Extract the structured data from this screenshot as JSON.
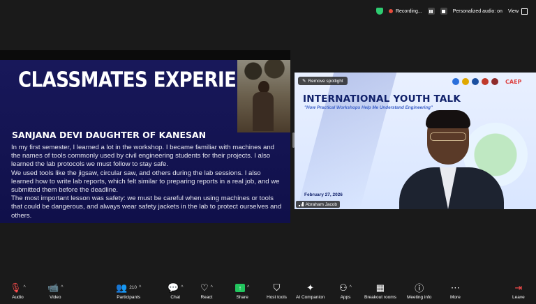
{
  "topbar": {
    "recording_label": "Recording...",
    "audio_label": "Personalized audio: on",
    "view_label": "View"
  },
  "slide": {
    "title": "CLASSMATES EXPERIENCE",
    "subtitle": "SANJANA DEVI DAUGHTER OF KANESAN",
    "paragraphs": [
      "In my first semester, I learned a lot in the workshop. I became familiar with machines and the names of tools commonly used by civil engineering students for their projects. I also learned the lab protocols we must follow to stay safe.",
      "We used tools like the jigsaw, circular saw, and others during the lab sessions. I also learned how to write lab reports, which felt similar to preparing reports in a real job, and we submitted them before the deadline.",
      "The most important lesson was safety: we must be careful when using machines or tools that could be dangerous, and always wear safety jackets in the lab to protect ourselves and others."
    ]
  },
  "video": {
    "spotlight_label": "Remove spotlight",
    "banner_title": "INTERNATIONAL YOUTH TALK",
    "banner_subtitle": "\"How Practical Workshops Help Me Understand Engineering\"",
    "banner_date": "February 27, 2026",
    "banner_logo_text": "CAEP",
    "participant_name": "Abraham Jacob"
  },
  "toolbar": {
    "audio": "Audio",
    "video": "Video",
    "participants": "Participants",
    "participant_count": "210",
    "chat": "Chat",
    "react": "React",
    "share": "Share",
    "host_tools": "Host tools",
    "ai_companion": "AI Companion",
    "apps": "Apps",
    "breakout_rooms": "Breakout rooms",
    "meeting_info": "Meeting info",
    "more": "More",
    "leave": "Leave"
  },
  "colors": {
    "slide_bg": "#14145a",
    "share_green": "#22c55e",
    "leave_red": "#ff4d4d",
    "banner_title": "#10206a"
  }
}
